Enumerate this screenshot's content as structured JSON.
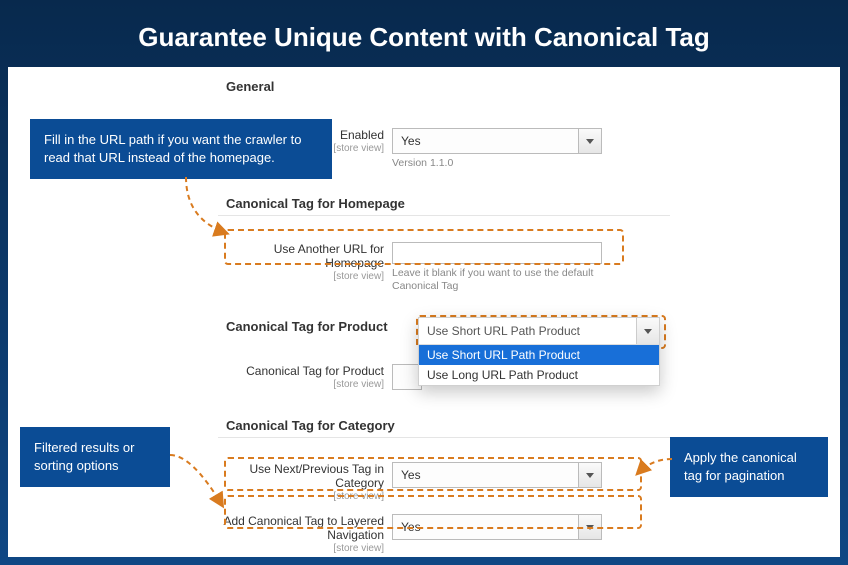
{
  "title": "Guarantee Unique Content with Canonical Tag",
  "sections": {
    "general": {
      "title": "General",
      "enabled": {
        "label": "Enabled",
        "scope": "[store view]",
        "value": "Yes"
      },
      "version": "Version 1.1.0"
    },
    "homepage": {
      "title": "Canonical Tag for Homepage",
      "useAnother": {
        "label": "Use Another URL for Homepage",
        "scope": "[store view]"
      },
      "note": "Leave it blank if you want to use the default Canonical Tag"
    },
    "product": {
      "title": "Canonical Tag for Product",
      "canonical": {
        "label": "Canonical Tag for Product",
        "scope": "[store view]"
      }
    },
    "category": {
      "title": "Canonical Tag for Category",
      "useNextPrev": {
        "label": "Use Next/Previous Tag in Category",
        "scope": "[store view]",
        "value": "Yes"
      },
      "addLayered": {
        "label": "Add Canonical Tag to Layered Navigation",
        "scope": "[store view]",
        "value": "Yes"
      }
    }
  },
  "dropdown": {
    "head": "Use Short URL Path Product",
    "options": [
      "Use Short URL Path Product",
      "Use Long URL Path Product"
    ]
  },
  "callouts": {
    "c1": "Fill in the URL path if you want the crawler to read that URL instead of the homepage.",
    "c2": "Filtered results or sorting options",
    "c3": "Apply the canonical tag for pagination"
  }
}
